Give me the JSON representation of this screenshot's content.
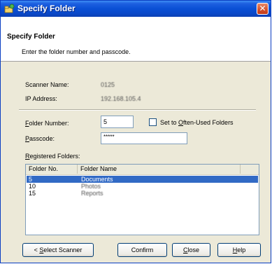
{
  "window": {
    "title": "Specify Folder",
    "close_glyph": "✕",
    "icon": "scanner-folder-icon"
  },
  "header": {
    "title": "Specify Folder",
    "subtitle": "Enter the folder number and passcode."
  },
  "info": {
    "scanner_label": "Scanner Name:",
    "scanner_value": "0125",
    "ip_label": "IP Address:",
    "ip_value": "192.168.105.4"
  },
  "form": {
    "folder_number_label": {
      "mnemonic": "F",
      "rest": "older Number:"
    },
    "folder_number_value": "5",
    "often_used_label": {
      "before": "Set to ",
      "mnemonic": "O",
      "after": "ften-Used Folders"
    },
    "often_used_checked": false,
    "passcode_label": {
      "mnemonic": "P",
      "rest": "asscode:"
    },
    "passcode_value": "*****",
    "registered_label": {
      "mnemonic": "R",
      "rest": "egistered Folders:"
    }
  },
  "list": {
    "columns": [
      "Folder No.",
      "Folder Name"
    ],
    "rows": [
      {
        "no": "5",
        "name": "Documents",
        "selected": true
      },
      {
        "no": "10",
        "name": "Photos",
        "selected": false
      },
      {
        "no": "15",
        "name": "Reports",
        "selected": false
      }
    ]
  },
  "buttons": {
    "select_scanner": {
      "before": "< ",
      "mnemonic": "S",
      "after": "elect Scanner"
    },
    "confirm": "Confirm",
    "close": {
      "mnemonic": "C",
      "after": "lose"
    },
    "help": {
      "mnemonic": "H",
      "after": "elp"
    }
  },
  "colors": {
    "title_bar": "#0a4fd5",
    "selection": "#316ac5",
    "close_button": "#d4502a",
    "dialog_bg": "#ece9d8"
  }
}
